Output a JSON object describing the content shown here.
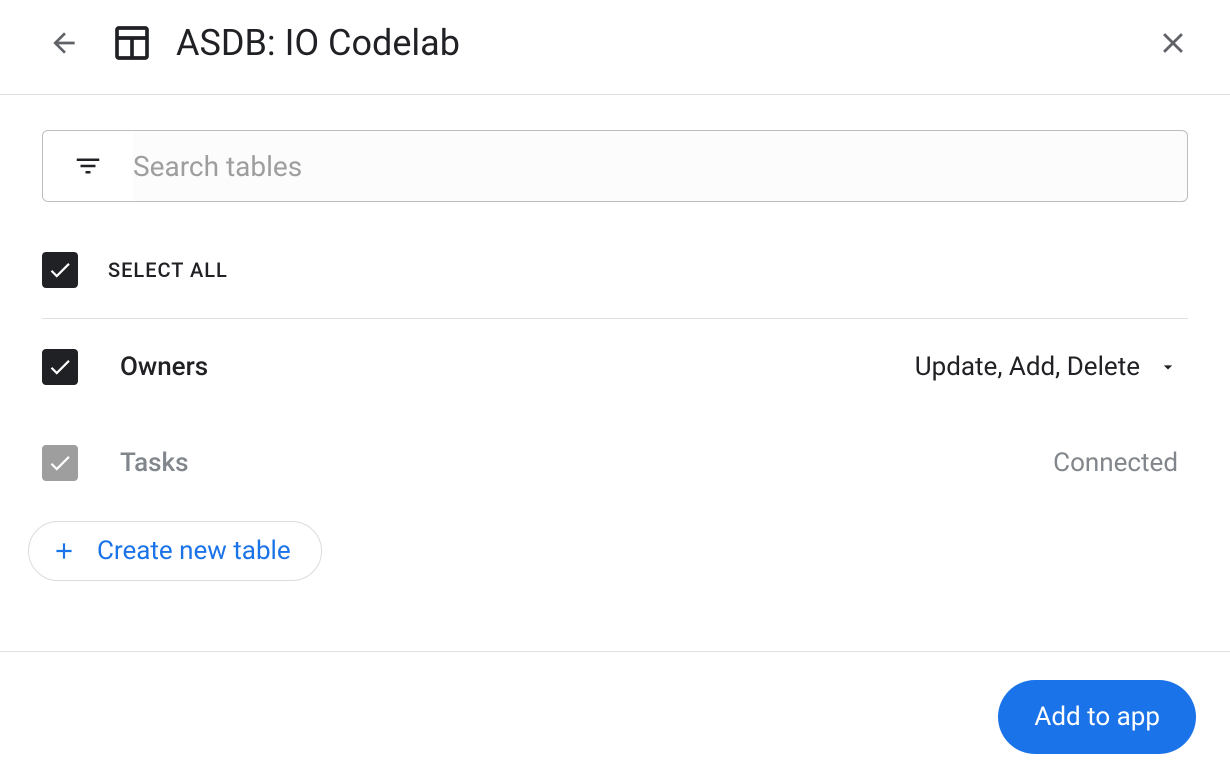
{
  "header": {
    "title": "ASDB: IO Codelab"
  },
  "search": {
    "placeholder": "Search tables"
  },
  "selectAll": {
    "label": "SELECT ALL",
    "checked": true
  },
  "tables": [
    {
      "name": "Owners",
      "checked": true,
      "disabled": false,
      "status": "Update, Add, Delete",
      "hasDropdown": true
    },
    {
      "name": "Tasks",
      "checked": true,
      "disabled": true,
      "status": "Connected",
      "hasDropdown": false
    }
  ],
  "createButton": {
    "label": "Create new table"
  },
  "footer": {
    "addButton": "Add to app"
  }
}
